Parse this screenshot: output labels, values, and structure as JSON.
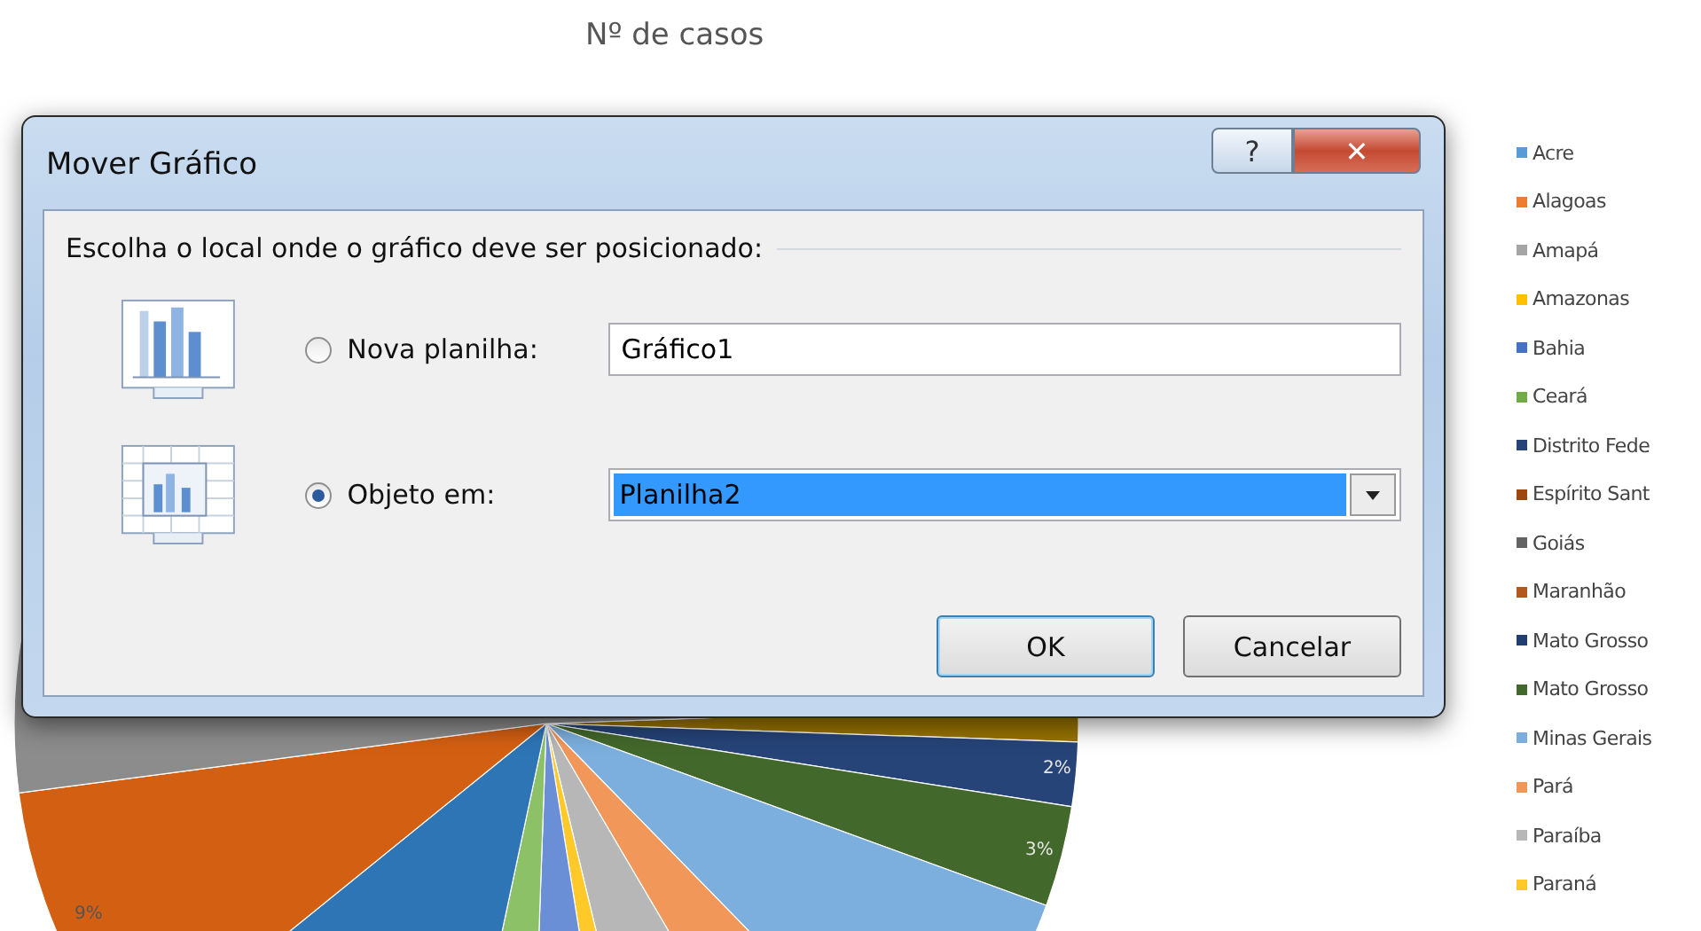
{
  "chart": {
    "title": "Nº de casos",
    "slice_labels": [
      {
        "text": "9%",
        "kind": "left"
      },
      {
        "text": "3%",
        "kind": "right"
      },
      {
        "text": "2%",
        "kind": "upper-right"
      }
    ],
    "legend": [
      {
        "label": "Acre",
        "color": "#5b9bd5"
      },
      {
        "label": "Alagoas",
        "color": "#ed7d31"
      },
      {
        "label": "Amapá",
        "color": "#a5a5a5"
      },
      {
        "label": "Amazonas",
        "color": "#ffc000"
      },
      {
        "label": "Bahia",
        "color": "#4472c4"
      },
      {
        "label": "Ceará",
        "color": "#70ad47"
      },
      {
        "label": "Distrito Fede",
        "color": "#264478"
      },
      {
        "label": "Espírito Sant",
        "color": "#9e480e"
      },
      {
        "label": "Goiás",
        "color": "#636363"
      },
      {
        "label": "Maranhão",
        "color": "#b3591e"
      },
      {
        "label": "Mato Grosso",
        "color": "#203f6e"
      },
      {
        "label": "Mato Grosso",
        "color": "#43682b"
      },
      {
        "label": "Minas Gerais",
        "color": "#7cafdd"
      },
      {
        "label": "Pará",
        "color": "#f1975a"
      },
      {
        "label": "Paraíba",
        "color": "#b7b7b7"
      },
      {
        "label": "Paraná",
        "color": "#ffc929"
      }
    ]
  },
  "dialog": {
    "title": "Mover Gráfico",
    "help": "?",
    "close": "✕",
    "heading": "Escolha o local onde o gráfico deve ser posicionado:",
    "options": [
      {
        "label": "Nova planilha:",
        "selected": false,
        "kind": "text",
        "value": "Gráfico1"
      },
      {
        "label": "Objeto em:",
        "selected": true,
        "kind": "combo",
        "value": "Planilha2"
      }
    ],
    "buttons": [
      {
        "label": "OK",
        "kind": "default"
      },
      {
        "label": "Cancelar",
        "kind": "normal"
      }
    ]
  }
}
